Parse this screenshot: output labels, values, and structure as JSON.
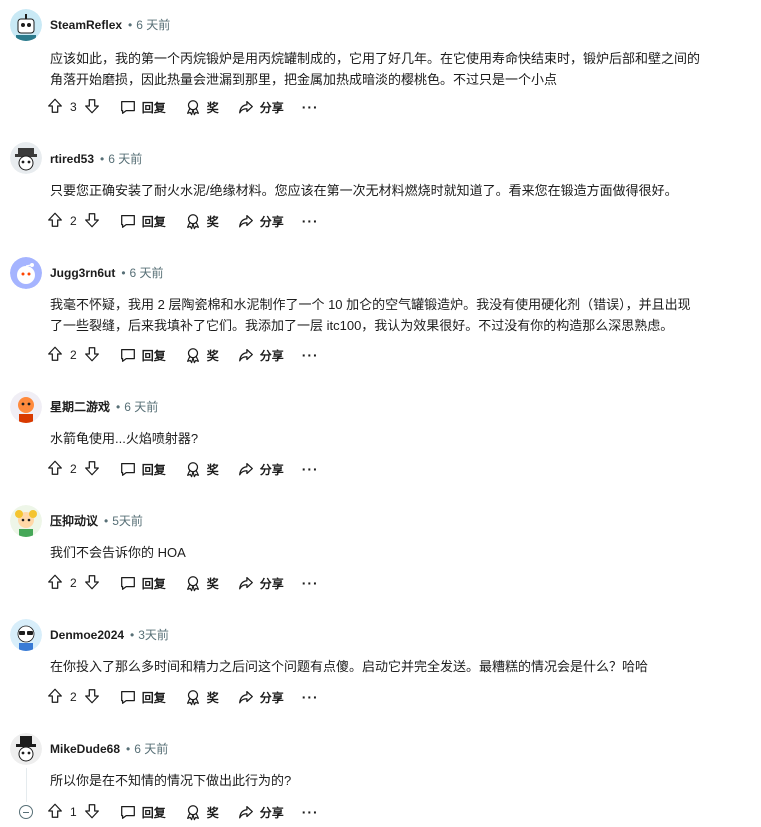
{
  "comments": [
    {
      "author": "SteamReflex",
      "time": "6 天前",
      "lines": [
        "应该如此，我的第一个丙烷锻炉是用丙烷罐制成的，它用了好几年。在它使用寿命快结束时，锻炉后部和壁之间的",
        "角落开始磨损，因此热量会泄漏到那里，把金属加热成暗淡的樱桃色。不过只是一个小点"
      ],
      "votes": "3",
      "avatar": "robot-avatar"
    },
    {
      "author": "rtired53",
      "time": "6 天前",
      "lines": [
        "只要您正确安装了耐火水泥/绝缘材料。您应该在第一次无材料燃烧时就知道了。看来您在锻造方面做得很好。"
      ],
      "votes": "2",
      "avatar": "hat-avatar"
    },
    {
      "author": "Jugg3rn6ut",
      "time": "6 天前",
      "lines": [
        "我毫不怀疑，我用 2 层陶瓷棉和水泥制作了一个 10 加仑的空气罐锻造炉。我没有使用硬化剂（错误），并且出现",
        "了一些裂缝，后来我填补了它们。我添加了一层 itc100，我认为效果很好。不过没有你的构造那么深思熟虑。"
      ],
      "votes": "2",
      "avatar": "default-avatar"
    },
    {
      "author": "星期二游戏",
      "time": "6 天前",
      "lines": [
        "水箭龟使用...火焰喷射器?"
      ],
      "votes": "2",
      "avatar": "orange-avatar"
    },
    {
      "author": "压抑动议",
      "time": "5天前",
      "lines": [
        "我们不会告诉你的 HOA"
      ],
      "votes": "2",
      "avatar": "flower-avatar"
    },
    {
      "author": "Denmoe2024",
      "time": "3天前",
      "lines": [
        "在你投入了那么多时间和精力之后问这个问题有点傻。启动它并完全发送。最糟糕的情况会是什么？哈哈"
      ],
      "votes": "2",
      "avatar": "sunglasses-avatar"
    },
    {
      "author": "MikeDude68",
      "time": "6 天前",
      "lines": [
        "所以你是在不知情的情况下做出此行为的?"
      ],
      "votes": "1",
      "avatar": "tophat-avatar"
    }
  ],
  "actions": {
    "reply": "回复",
    "award": "奖",
    "share": "分享",
    "more": "···"
  },
  "colors": {
    "text": "#1c1c1c",
    "meta": "#576f76",
    "thread": "#e5ebee"
  }
}
